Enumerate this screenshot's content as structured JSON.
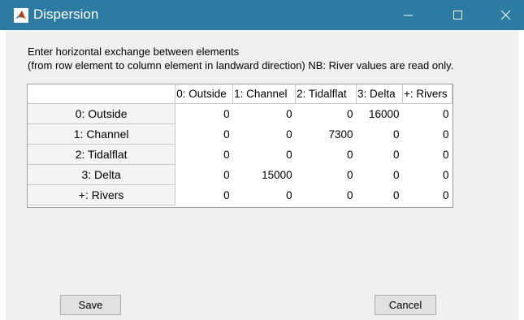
{
  "window": {
    "title": "Dispersion",
    "accent_color": "#2c7ba3",
    "icon": "matlab-icon"
  },
  "instructions": {
    "line1": "Enter horizontal exchange between elements",
    "line2": "(from row element to column element in landward direction) NB: River values are read only."
  },
  "table": {
    "columns": [
      "0: Outside",
      "1: Channel",
      "2: Tidalflat",
      "3: Delta",
      "+: Rivers"
    ],
    "rows": [
      {
        "label": "0: Outside",
        "values": [
          "0",
          "0",
          "0",
          "16000",
          "0"
        ]
      },
      {
        "label": "1: Channel",
        "values": [
          "0",
          "0",
          "7300",
          "0",
          "0"
        ]
      },
      {
        "label": "2: Tidalflat",
        "values": [
          "0",
          "0",
          "0",
          "0",
          "0"
        ]
      },
      {
        "label": "3: Delta",
        "values": [
          "0",
          "15000",
          "0",
          "0",
          "0"
        ]
      },
      {
        "label": "+: Rivers",
        "values": [
          "0",
          "0",
          "0",
          "0",
          "0"
        ]
      }
    ]
  },
  "buttons": {
    "save": "Save",
    "cancel": "Cancel"
  }
}
